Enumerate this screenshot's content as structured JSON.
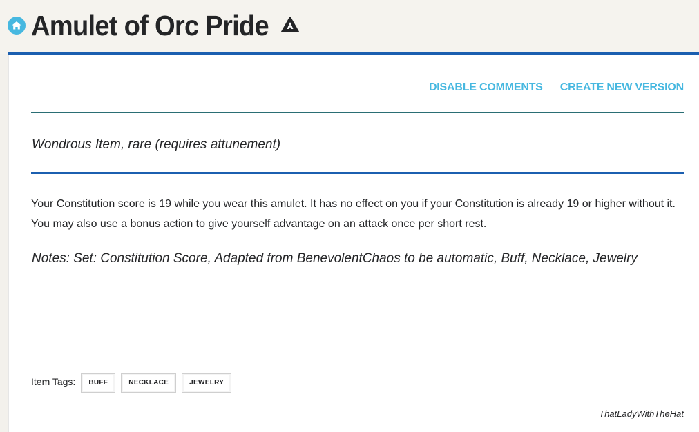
{
  "page": {
    "title": "Amulet of Orc Pride",
    "home_icon": "home-icon",
    "source_icon": "homebrew-triangle-icon"
  },
  "actions": {
    "disable_comments": "DISABLE COMMENTS",
    "create_new_version": "CREATE NEW VERSION"
  },
  "item": {
    "type_line": "Wondrous Item, rare (requires attunement)",
    "description": "Your Constitution score is 19 while you wear this amulet. It has no effect on you if your Constitution is already 19 or higher without it. You may also use a bonus action to give yourself advantage on an attack once per short rest.",
    "notes": "Notes: Set: Constitution Score, Adapted from BenevolentChaos to be automatic, Buff, Necklace, Jewelry"
  },
  "tags": {
    "label": "Item Tags:",
    "items": [
      "BUFF",
      "NECKLACE",
      "JEWELRY"
    ]
  },
  "author": "ThatLadyWithTheHat",
  "colors": {
    "accent_link": "#47b8e0",
    "rule_blue": "#1b5fb0",
    "rule_teal": "#2a6e74",
    "text": "#242527"
  }
}
